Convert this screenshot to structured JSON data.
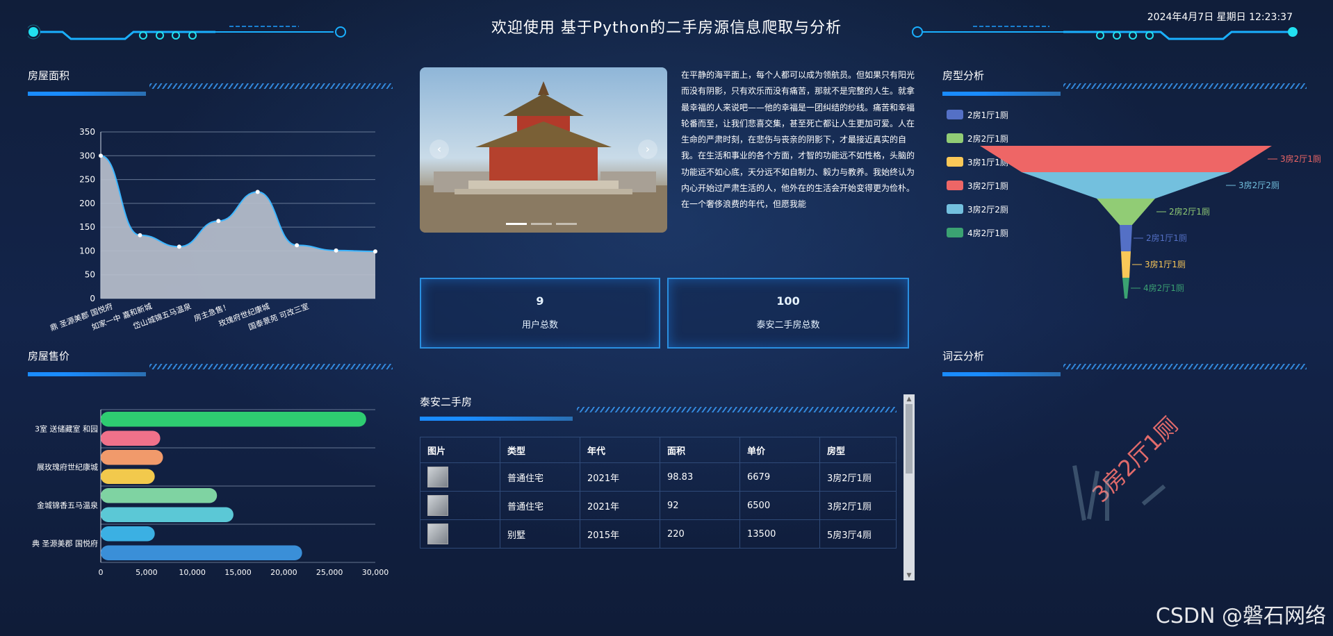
{
  "header": {
    "title": "欢迎使用 基于Python的二手房源信息爬取与分析",
    "datetime": "2024年4月7日 星期日 12:23:37"
  },
  "area_chart": {
    "title": "房屋面积",
    "chart_data": {
      "type": "area",
      "categories": [
        "鼎 圣源美郡 国悦府",
        "如家一中 嘉和新城",
        "岱山城锦五马温泉",
        "房主急售！",
        "玫瑰府世纪康城",
        "国泰景苑 可改三室",
        "",
        ""
      ],
      "values": [
        300,
        133,
        109,
        163,
        224,
        112,
        101,
        99
      ],
      "ylim": [
        0,
        350
      ],
      "yticks": [
        0,
        50,
        100,
        150,
        200,
        250,
        300,
        350
      ]
    }
  },
  "price_chart": {
    "title": "房屋售价",
    "chart_data": {
      "type": "bar",
      "orientation": "horizontal",
      "category_labels": [
        "3室 送储藏室 和园",
        "展玫瑰府世纪康城",
        "金城锦香五马温泉",
        "典 圣源美郡 国悦府"
      ],
      "values": [
        29000,
        6500,
        6800,
        5900,
        12700,
        14500,
        5900,
        22000
      ],
      "colors": [
        "#2ecc71",
        "#f0718a",
        "#f19a6b",
        "#f2c94c",
        "#7fd3a2",
        "#5bc8d6",
        "#3bb0e3",
        "#3a8fd8"
      ],
      "xlim": [
        0,
        30000
      ],
      "xticks": [
        "0",
        "5,000",
        "10,000",
        "15,000",
        "20,000",
        "25,000",
        "30,000"
      ]
    }
  },
  "intro_text": "在平静的海平面上，每个人都可以成为领航员。但如果只有阳光而没有阴影，只有欢乐而没有痛苦，那就不是完整的人生。就拿最幸福的人来说吧——他的幸福是一团纠结的纱线。痛苦和幸福轮番而至，让我们悲喜交集，甚至死亡都让人生更加可爱。人在生命的严肃时刻，在悲伤与丧亲的阴影下，才最接近真实的自我。在生活和事业的各个方面，才智的功能远不如性格，头脑的功能远不如心底，天分远不如自制力、毅力与教养。我始终认为内心开始过严肃生活的人，他外在的生活会开始变得更为俭朴。在一个奢侈浪费的年代，但愿我能",
  "stats": [
    {
      "value": "9",
      "label": "用户总数"
    },
    {
      "value": "100",
      "label": "泰安二手房总数"
    }
  ],
  "table": {
    "title": "泰安二手房",
    "headers": [
      "图片",
      "类型",
      "年代",
      "面积",
      "单价",
      "房型"
    ],
    "rows": [
      [
        "",
        "普通住宅",
        "2021年",
        "98.83",
        "6679",
        "3房2厅1厕"
      ],
      [
        "",
        "普通住宅",
        "2021年",
        "92",
        "6500",
        "3房2厅1厕"
      ],
      [
        "",
        "别墅",
        "2015年",
        "220",
        "13500",
        "5房3厅4厕"
      ]
    ]
  },
  "funnel_chart": {
    "title": "房型分析",
    "chart_data": {
      "type": "funnel",
      "legend": [
        "2房1厅1厕",
        "2房2厅1厕",
        "3房1厅1厕",
        "3房2厅1厕",
        "3房2厅2厕",
        "4房2厅1厕"
      ],
      "legend_colors": [
        "#5470c6",
        "#91cc75",
        "#fac858",
        "#ee6666",
        "#73c0de",
        "#3ba272"
      ],
      "stages": [
        {
          "name": "3房2厅1厕",
          "color": "#ee6666"
        },
        {
          "name": "3房2厅2厕",
          "color": "#73c0de"
        },
        {
          "name": "2房2厅1厕",
          "color": "#91cc75"
        },
        {
          "name": "2房1厅1厕",
          "color": "#5470c6"
        },
        {
          "name": "3房1厅1厕",
          "color": "#fac858"
        },
        {
          "name": "4房2厅1厕",
          "color": "#3ba272"
        }
      ]
    }
  },
  "wordcloud": {
    "title": "词云分析",
    "main_word": "3房2厅1厕"
  },
  "watermark": "CSDN @磐石网络"
}
